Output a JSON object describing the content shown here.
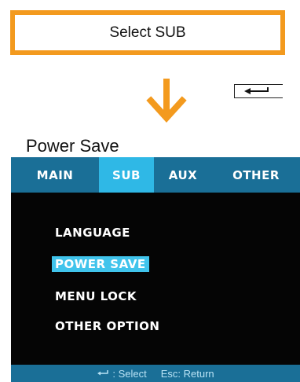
{
  "callout": {
    "label": "Select SUB"
  },
  "caption": "Power Save",
  "tabs": [
    {
      "label": "MAIN",
      "active": false
    },
    {
      "label": "SUB",
      "active": true
    },
    {
      "label": "AUX",
      "active": false
    },
    {
      "label": "OTHER",
      "active": false
    }
  ],
  "menu": [
    {
      "label": "LANGUAGE",
      "selected": false
    },
    {
      "label": "POWER SAVE",
      "selected": true
    },
    {
      "label": "MENU LOCK",
      "selected": false
    },
    {
      "label": "OTHER OPTION",
      "selected": false
    }
  ],
  "status": {
    "select_label": ": Select",
    "return_label": "Esc: Return"
  },
  "icons": {
    "arrow": "arrow-down-icon",
    "enter": "enter-key-icon"
  },
  "colors": {
    "accent_orange": "#f39a1e",
    "tab_bar": "#1a6f97",
    "tab_active": "#2fb8e6",
    "selection": "#40c4ec"
  }
}
